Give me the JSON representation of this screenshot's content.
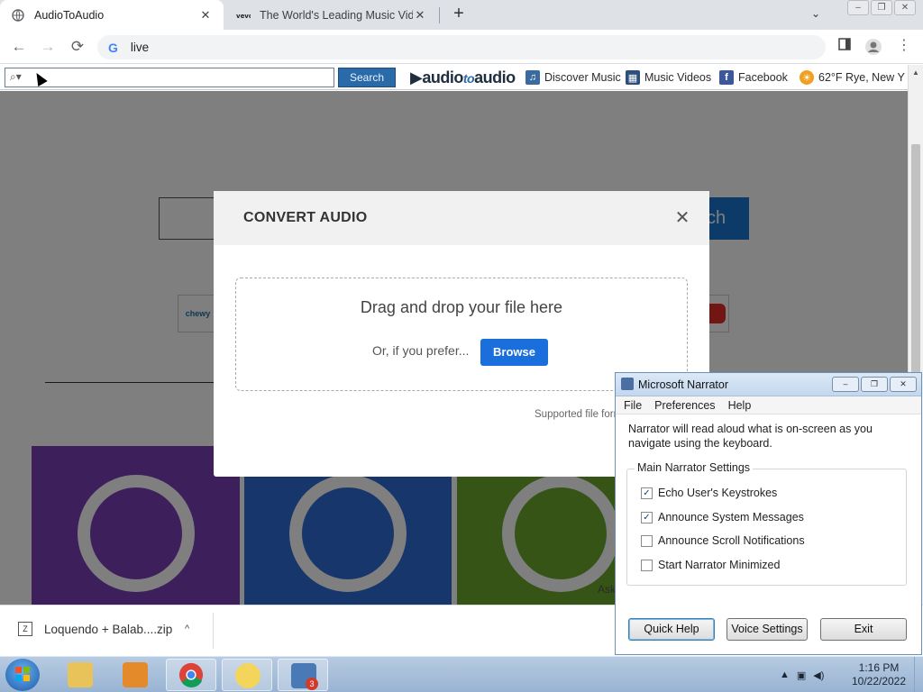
{
  "browser": {
    "tabs": [
      {
        "title": "AudioToAudio",
        "active": true,
        "icon": "globe-icon"
      },
      {
        "title": "The World's Leading Music Video",
        "active": false,
        "icon": "vevo-icon"
      }
    ],
    "new_tab_symbol": "+",
    "tab_search_symbol": "⌄",
    "window_buttons": [
      "–",
      "❐",
      "✕"
    ],
    "address": "live",
    "nav": {
      "back": "←",
      "forward": "→",
      "reload": "⟳"
    }
  },
  "a2a_toolbar": {
    "search_placeholder": "",
    "search_button": "Search",
    "logo_left": "▶audio",
    "logo_to": "to",
    "logo_right": "audio",
    "links": [
      {
        "label": "Discover Music",
        "icon": "music-note-icon",
        "color": "#3b6aa0"
      },
      {
        "label": "Music Videos",
        "icon": "film-icon",
        "color": "#2c4f7c"
      },
      {
        "label": "Facebook",
        "icon": "facebook-icon",
        "color": "#3b5998"
      },
      {
        "label": "62°F Rye, New Y",
        "icon": "weather-icon",
        "color": "#f0a020"
      }
    ]
  },
  "background_page": {
    "search_button_partial": "ch",
    "chewy_label": "chewy",
    "supported_partial": "Supported file form",
    "ask_partial": "Ask"
  },
  "modal": {
    "title": "CONVERT AUDIO",
    "close_symbol": "✕",
    "drop_title": "Drag and drop your file here",
    "drop_alt": "Or, if you prefer...",
    "browse_button": "Browse"
  },
  "download_shelf": {
    "file_name": "Loquendo + Balab....zip",
    "chevron": "^"
  },
  "narrator": {
    "title": "Microsoft Narrator",
    "menu": [
      "File",
      "Preferences",
      "Help"
    ],
    "description": "Narrator will read aloud what is on-screen as you navigate using the keyboard.",
    "group_title": "Main Narrator Settings",
    "options": [
      {
        "label": "Echo User's Keystrokes",
        "checked": true
      },
      {
        "label": "Announce System Messages",
        "checked": true
      },
      {
        "label": "Announce Scroll Notifications",
        "checked": false
      },
      {
        "label": "Start Narrator Minimized",
        "checked": false
      }
    ],
    "buttons": [
      "Quick Help",
      "Voice Settings",
      "Exit"
    ],
    "window_buttons": [
      "–",
      "❐",
      "✕"
    ]
  },
  "taskbar": {
    "items": [
      {
        "name": "explorer-folder-icon",
        "color": "#e8c35a"
      },
      {
        "name": "media-player-icon",
        "color": "#e58a2a"
      },
      {
        "name": "chrome-icon",
        "color": "#db4437"
      },
      {
        "name": "narrator-app-icon",
        "color": "#f2d55a"
      },
      {
        "name": "search-app-icon",
        "color": "#4a7ab5",
        "badge": "3"
      }
    ],
    "time": "1:16 PM",
    "date": "10/22/2022"
  },
  "colors": {
    "chrome_tabstrip": "#dee1e6",
    "a2a_button": "#2a6aa8",
    "browse_button": "#1a6fdc",
    "overlay": "rgba(0,0,0,0.5)"
  }
}
